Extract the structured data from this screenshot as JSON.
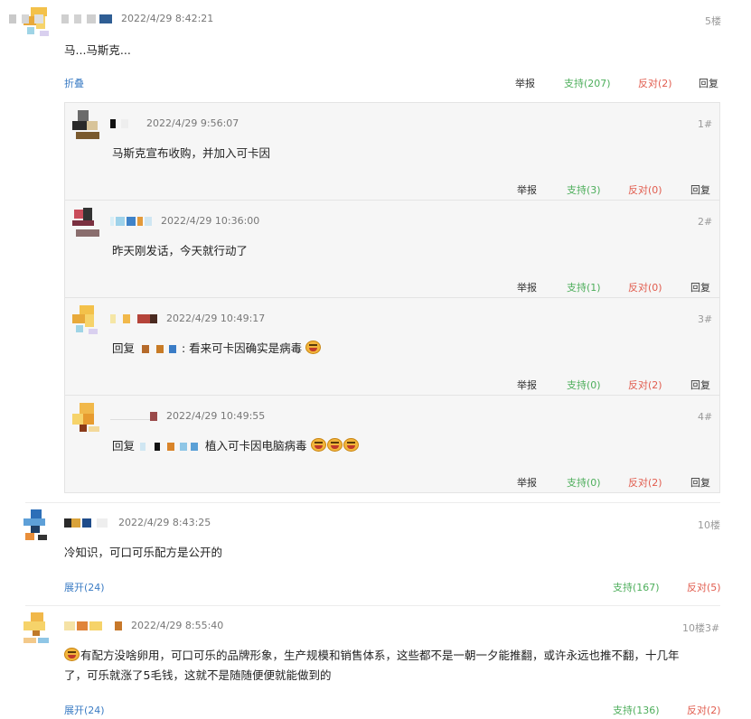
{
  "colors": {
    "link": "#3b7cc4",
    "support": "#4dae5b",
    "oppose": "#e15c4e"
  },
  "icons": {
    "emoji": "laughing-tears-emoji",
    "avatar": "pixelated-avatar"
  },
  "comments": [
    {
      "time": "2022/4/29 8:42:21",
      "floor": "5楼",
      "text": "马...马斯克...",
      "fold": "折叠",
      "report": "举报",
      "support": "支持(207)",
      "oppose": "反对(2)",
      "reply": "回复",
      "replies": [
        {
          "time": "2022/4/29 9:56:07",
          "floor": "1#",
          "text": "马斯克宣布收购，并加入可卡因",
          "report": "举报",
          "support": "支持(3)",
          "oppose": "反对(0)",
          "reply": "回复"
        },
        {
          "time": "2022/4/29 10:36:00",
          "floor": "2#",
          "text": "昨天刚发话，今天就行动了",
          "report": "举报",
          "support": "支持(1)",
          "oppose": "反对(0)",
          "reply": "回复"
        },
        {
          "time": "2022/4/29 10:49:17",
          "floor": "3#",
          "reply_prefix": "回复",
          "text": ": 看来可卡因确实是病毒",
          "report": "举报",
          "support": "支持(0)",
          "oppose": "反对(2)",
          "reply": "回复"
        },
        {
          "time": "2022/4/29 10:49:55",
          "floor": "4#",
          "reply_prefix": "回复",
          "text": "植入可卡因电脑病毒",
          "report": "举报",
          "support": "支持(0)",
          "oppose": "反对(2)",
          "reply": "回复"
        }
      ]
    },
    {
      "time": "2022/4/29 8:43:25",
      "floor": "10楼",
      "text": "冷知识，可口可乐配方是公开的",
      "expand": "展开(24)",
      "support": "支持(167)",
      "oppose": "反对(5)"
    },
    {
      "time": "2022/4/29 8:55:40",
      "floor": "10楼3#",
      "text_line1": "有配方没啥卵用，可口可乐的品牌形象，生产规模和销售体系，这些都不是一朝一夕能推翻，或许永远也推不翻，十几年",
      "text_line2": "了，可乐就涨了5毛钱，这就不是随随便便就能做到的",
      "expand": "展开(24)",
      "support": "支持(136)",
      "oppose": "反对(2)"
    }
  ]
}
